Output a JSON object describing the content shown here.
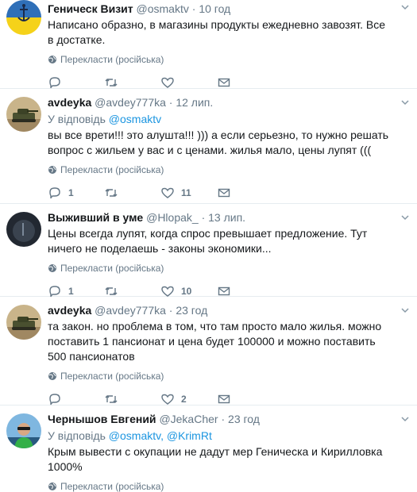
{
  "translate_label": "Перекласти (російська)",
  "tweets": [
    {
      "name": "Геническ Визит",
      "handle": "@osmaktv",
      "dot": "·",
      "time": "10 год",
      "reply_prefix": "",
      "reply_to": [],
      "text": "Написано образно, в магазины продукты ежедневно завозят. Все в достатке.",
      "reply_count": "",
      "retweet_count": "",
      "like_count": "",
      "avatar": "flag"
    },
    {
      "name": "avdeyka",
      "handle": "@avdey777ka",
      "dot": "·",
      "time": "12 лип.",
      "reply_prefix": "У відповідь",
      "reply_to": [
        "@osmaktv"
      ],
      "text": "вы все врети!!! это алушта!!! ))) а если серьезно, то нужно решать вопрос с жильем у вас и с ценами. жилья мало, цены лупят (((",
      "reply_count": "1",
      "retweet_count": "",
      "like_count": "11",
      "avatar": "tank"
    },
    {
      "name": "Выживший в уме",
      "handle": "@Hlopak_",
      "dot": "·",
      "time": "13 лип.",
      "reply_prefix": "",
      "reply_to": [],
      "text": "Цены всегда лупят, когда спрос превышает предложение. Тут ничего не поделаешь - законы экономики...",
      "reply_count": "1",
      "retweet_count": "",
      "like_count": "10",
      "avatar": "dark"
    },
    {
      "name": "avdeyka",
      "handle": "@avdey777ka",
      "dot": "·",
      "time": "23 год",
      "reply_prefix": "",
      "reply_to": [],
      "text": "та закон. но проблема в том, что там просто мало жилья. можно поставить 1 пансионат и цена будет 100000 и можно поставить 500 пансионатов",
      "reply_count": "",
      "retweet_count": "",
      "like_count": "2",
      "avatar": "tank"
    },
    {
      "name": "Чернышов Евгений",
      "handle": "@JekaCher",
      "dot": "·",
      "time": "23 год",
      "reply_prefix": "У відповідь",
      "reply_to": [
        "@osmaktv",
        "@KrimRt"
      ],
      "text": "Крым вывести с окупации не дадут мер Геническа и Кирилловка 1000%",
      "reply_count": "",
      "retweet_count": "",
      "like_count": "",
      "avatar": "person"
    }
  ],
  "colors": {
    "text": "#14171a",
    "secondary": "#657786",
    "link": "#1b95e0",
    "border": "#e6ecf0",
    "flag_blue": "#2f6fb8",
    "flag_yellow": "#f5d21a"
  }
}
